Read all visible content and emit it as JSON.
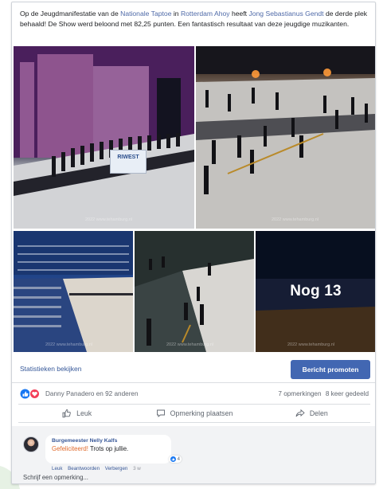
{
  "post": {
    "text_1": "Op de Jeugdmanifestatie van de ",
    "link_1": "Nationale Taptoe",
    "text_2": " in ",
    "link_2": "Rotterdam Ahoy",
    "text_3": " heeft ",
    "link_3": "Jong Sebastianus Gendt",
    "text_4": " de derde plek behaald! De Show werd beloond met 82,25 punten. Een fantastisch resultaat van deze jeugdige muzikanten."
  },
  "photos": {
    "watermark": "2022 www.tehamburg.nl",
    "banner_text": "RIWEST",
    "more_label": "Nog 13"
  },
  "insights": {
    "link_label": "Statistieken bekijken",
    "promote_label": "Bericht promoten"
  },
  "reactions": {
    "names": "Danny Panadero en 92 anderen",
    "comments_count": "7 opmerkingen",
    "shares_count": "8 keer gedeeld",
    "icons": [
      "like-icon",
      "love-icon"
    ],
    "colors": {
      "like": "#1877f2",
      "love": "#f33e58"
    }
  },
  "actions": {
    "like": "Leuk",
    "comment": "Opmerking plaatsen",
    "share": "Delen"
  },
  "comment": {
    "author": "Burgemeester Nelly Kalfs",
    "mention": "Gefeliciteerd!",
    "text": " Trots op jullie.",
    "reaction_count": "4",
    "like_label": "Leuk",
    "reply_label": "Beantwoorden",
    "hide_label": "Verbergen",
    "time": "3 w",
    "input_placeholder": "Schrijf een opmerking..."
  },
  "colors": {
    "link": "#365899",
    "button_blue": "#4267b2"
  }
}
